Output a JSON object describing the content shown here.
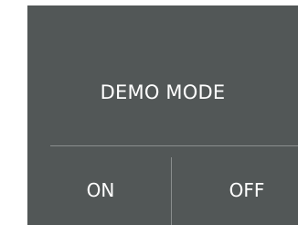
{
  "dialog": {
    "title": "DEMO MODE",
    "on_label": "ON",
    "off_label": "OFF"
  },
  "colors": {
    "panel_background": "#525757",
    "text": "#ffffff",
    "divider": "#8a8e8e",
    "page_background": "#ffffff"
  }
}
